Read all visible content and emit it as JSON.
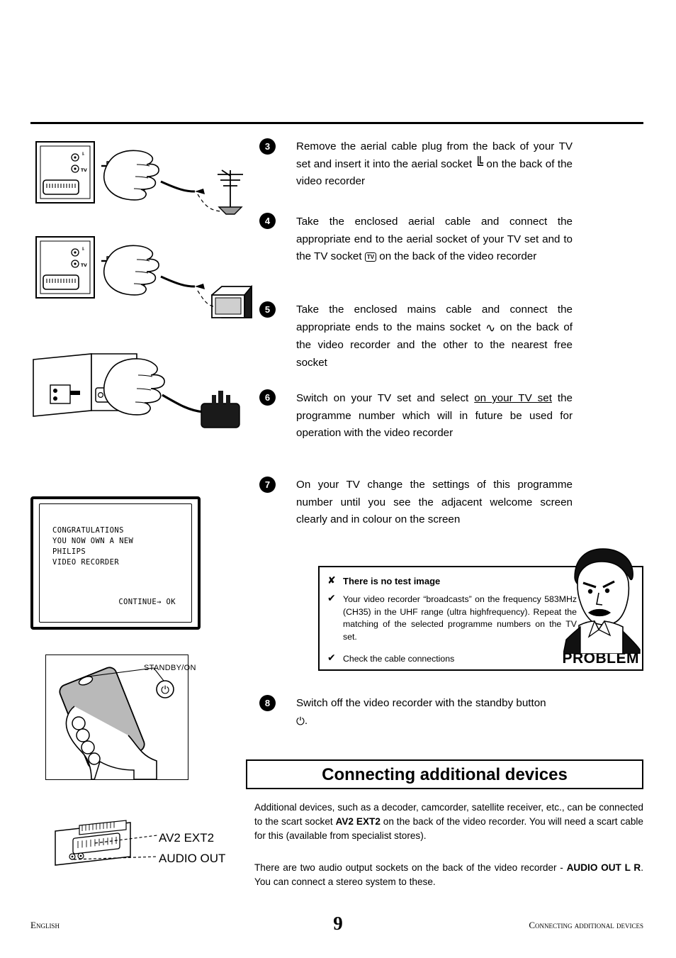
{
  "page": {
    "number": "9",
    "footer_left": "English",
    "footer_right": "Connecting additional devices"
  },
  "steps": [
    {
      "num": "3",
      "text_before": "Remove the aerial cable plug from the back of your TV set and insert it into the aerial socket ",
      "icon": "aerial-icon",
      "text_after": " on the back of the video recorder"
    },
    {
      "num": "4",
      "text_before": "Take the enclosed aerial cable and connect the appropriate end to the aerial socket of your TV set and to the TV socket ",
      "icon": "tv-socket-icon",
      "icon_label": "TV",
      "text_after": " on the back of the video recorder"
    },
    {
      "num": "5",
      "text_before": "Take the enclosed mains cable and connect the appropriate ends to the mains socket ",
      "icon": "mains-sine-icon",
      "text_after": " on the back of the video recorder and the other to the nearest free socket"
    },
    {
      "num": "6",
      "text_before": "Switch on your TV set and select ",
      "underlined": "on your TV set",
      "text_after": " the programme number which will in future be used for operation with the video recorder"
    },
    {
      "num": "7",
      "text_before": "On your TV change the settings of this programme number until you see the adjacent welcome screen clearly and in colour on the screen"
    },
    {
      "num": "8",
      "text_before": "Switch off the video recorder with the standby button ",
      "icon": "standby-power-icon",
      "text_after": "."
    }
  ],
  "tv_screen": {
    "lines": [
      "CONGRATULATIONS",
      "YOU NOW OWN A NEW",
      "PHILIPS",
      "VIDEO RECORDER"
    ],
    "continue": "CONTINUE→ OK"
  },
  "remote": {
    "standby_label": "STANDBY/ON"
  },
  "scart_labels": {
    "av2": "AV2 EXT2",
    "audio_out": "AUDIO OUT",
    "aerial_small": "ᐧ",
    "tv_small": "TV"
  },
  "problem_box": {
    "title": "There is no test image",
    "item1": "Your video recorder “broadcasts” on the frequency 583MHz (CH35) in the UHF range (ultra highfrequency). Repeat the matching of the selected programme numbers on the TV set.",
    "item2": "Check the cable connections",
    "word": "PROBLEM",
    "cross_icon": "✘",
    "check_icon": "✔"
  },
  "section": {
    "heading": "Connecting additional devices",
    "para1_a": "Additional devices, such as a decoder, camcorder, satellite receiver, etc., can be connected to the scart socket ",
    "para1_b": "AV2 EXT2",
    "para1_c": " on the back of the video recorder. You will need a scart cable for this (available from specialist stores).",
    "para2_a": "There are two audio output sockets on the back of the video recorder - ",
    "para2_b": "AUDIO OUT L R",
    "para2_c": ". You can connect a stereo system to these."
  }
}
